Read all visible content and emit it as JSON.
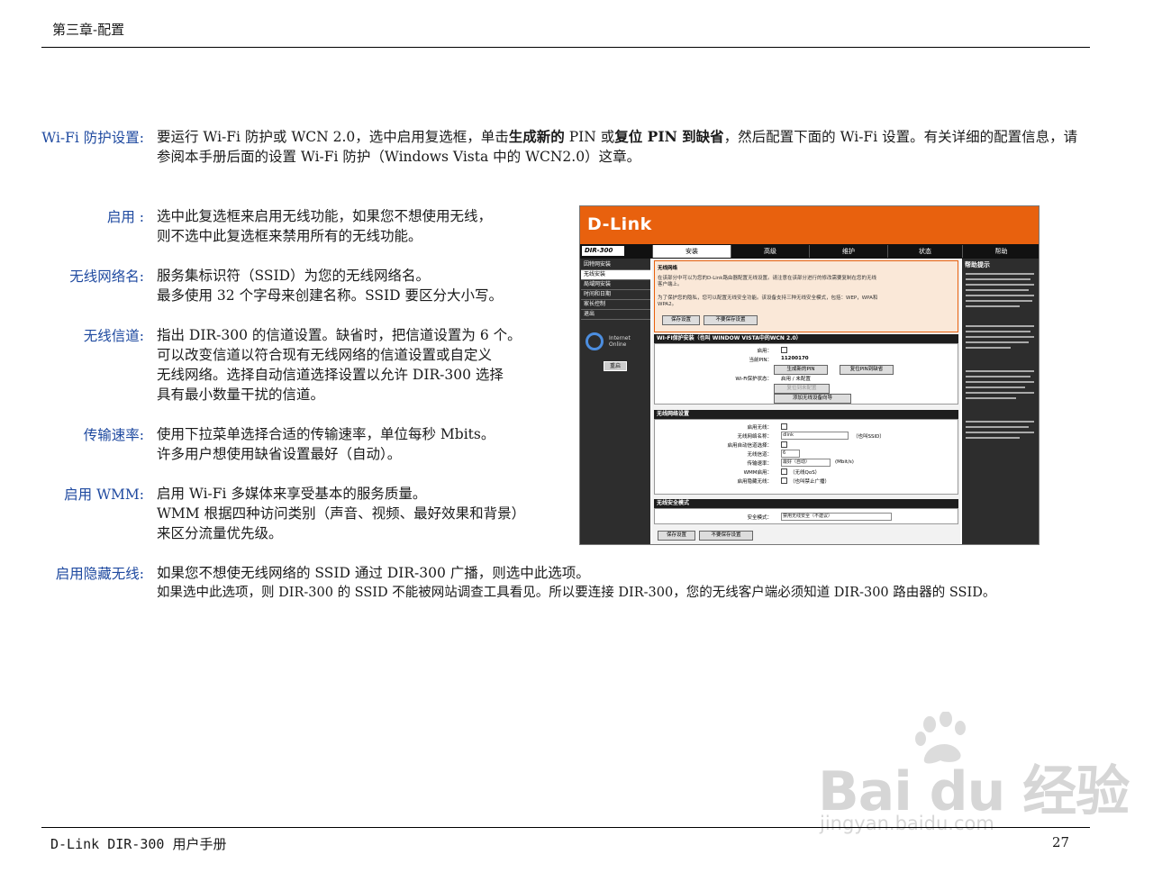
{
  "header": {
    "chapter": "第三章-配置"
  },
  "footer": {
    "manual": "D-Link DIR-300 用户手册",
    "page": "27"
  },
  "wifi_protect": {
    "term": "Wi-Fi 防护设置:",
    "line1_a": "要运行 Wi-Fi 防护或 WCN 2.0，选中启用复选框，单击",
    "line1_b": "生成新的",
    "line1_c": " PIN 或",
    "line1_d": "复位",
    "line1_e": " PIN 到缺省",
    "line1_f": "，然后配置下面的 Wi-Fi 设置。有关详细的配置信息，请",
    "line2": "参阅本手册后面的设置 Wi-Fi 防护（Windows Vista 中的 WCN2.0）这章。"
  },
  "items": [
    {
      "term": "启用 :",
      "lines": [
        "选中此复选框来启用无线功能，如果您不想使用无线，",
        "则不选中此复选框来禁用所有的无线功能。"
      ]
    },
    {
      "term": "无线网络名:",
      "lines": [
        "服务集标识符（SSID）为您的无线网络名。",
        "最多使用 32 个字母来创建名称。SSID 要区分大小写。"
      ]
    },
    {
      "term": "无线信道:",
      "lines": [
        "指出 DIR-300 的信道设置。缺省时，把信道设置为 6 个。",
        "可以改变信道以符合现有无线网络的信道设置或自定义",
        "无线网络。选择自动信道选择设置以允许 DIR-300 选择",
        "具有最小数量干扰的信道。"
      ]
    },
    {
      "term": "传输速率:",
      "lines": [
        "使用下拉菜单选择合适的传输速率，单位每秒 Mbits。",
        "许多用户想使用缺省设置最好（自动）。"
      ]
    },
    {
      "term": "启用 WMM:",
      "lines": [
        "启用 Wi-Fi 多媒体来享受基本的服务质量。",
        "WMM 根据四种访问类别（声音、视频、最好效果和背景）",
        "来区分流量优先级。"
      ]
    },
    {
      "term": "启用隐藏无线:",
      "lines": [
        "如果您不想使无线网络的 SSID 通过 DIR-300 广播，则选中此选项。",
        "如果选中此选项，则 DIR-300 的 SSID 不能被网站调查工具看见。所以要连接 DIR-300，您的无线客户端必须知道 DIR-300 路由器的 SSID。"
      ]
    }
  ],
  "screenshot": {
    "logo": "D-Link",
    "model": "DIR-300",
    "tabs": [
      "安装",
      "高级",
      "维护",
      "状态",
      "帮助"
    ],
    "nav": [
      "因特网安装",
      "无线安装",
      "局域网安装",
      "时间和日期",
      "家长控制",
      "退出"
    ],
    "ie_text": "Internet\nOnline",
    "reboot": "重启",
    "help_title": "帮助提示",
    "intro_title": "无线网络",
    "intro_text1": "在该部分中可以为您的D-Link路由器配置无线设置。请注意在该部分进行的修改需要复制在您的无线",
    "intro_text2": "客户端上。",
    "intro_text3": "为了保护您的隐私，您可以配置无线安全功能。该设备支持三种无线安全模式，包括：WEP，WPA和",
    "intro_text4": "WPA2。",
    "save_btn": "保存设置",
    "nosave_btn": "不要保存设置",
    "wps_hdr": "WI-FI保护安装（也叫 WINDOW VISTA中的WCN 2.0）",
    "wps_enable": "启用：",
    "wps_pin_label": "当前PIN：",
    "wps_pin": "11200170",
    "wps_gen": "生成新的PIN",
    "wps_reset": "复位PIN到缺省",
    "wps_state_label": "Wi-Fi保护状态：",
    "wps_state": "启用 / 未配置",
    "wps_reset_unconf": "复位到未配置",
    "wps_add": "添加无线设备向导",
    "wl_hdr": "无线网络设置",
    "wl_enable": "启用无线：",
    "wl_name": "无线网络名称：",
    "wl_name_val": "dlink",
    "wl_name_note": "（也叫SSID）",
    "wl_auto": "启用自动信道选择：",
    "wl_channel": "无线信道：",
    "wl_channel_val": "6",
    "wl_rate": "传输速率：",
    "wl_rate_val": "最好（自动）",
    "wl_rate_unit": "(Mbit/s)",
    "wl_wmm": "WMM启用：",
    "wl_wmm_note": "（无线QoS）",
    "wl_hidden": "启用隐藏无线：",
    "wl_hidden_note": "（也叫禁止广播）",
    "sec_hdr": "无线安全模式",
    "sec_mode": "安全模式：",
    "sec_mode_val": "禁用无线安全（不建议）"
  },
  "watermark": {
    "brand": "Bai du 经验",
    "url": "jingyan.baidu.com"
  }
}
